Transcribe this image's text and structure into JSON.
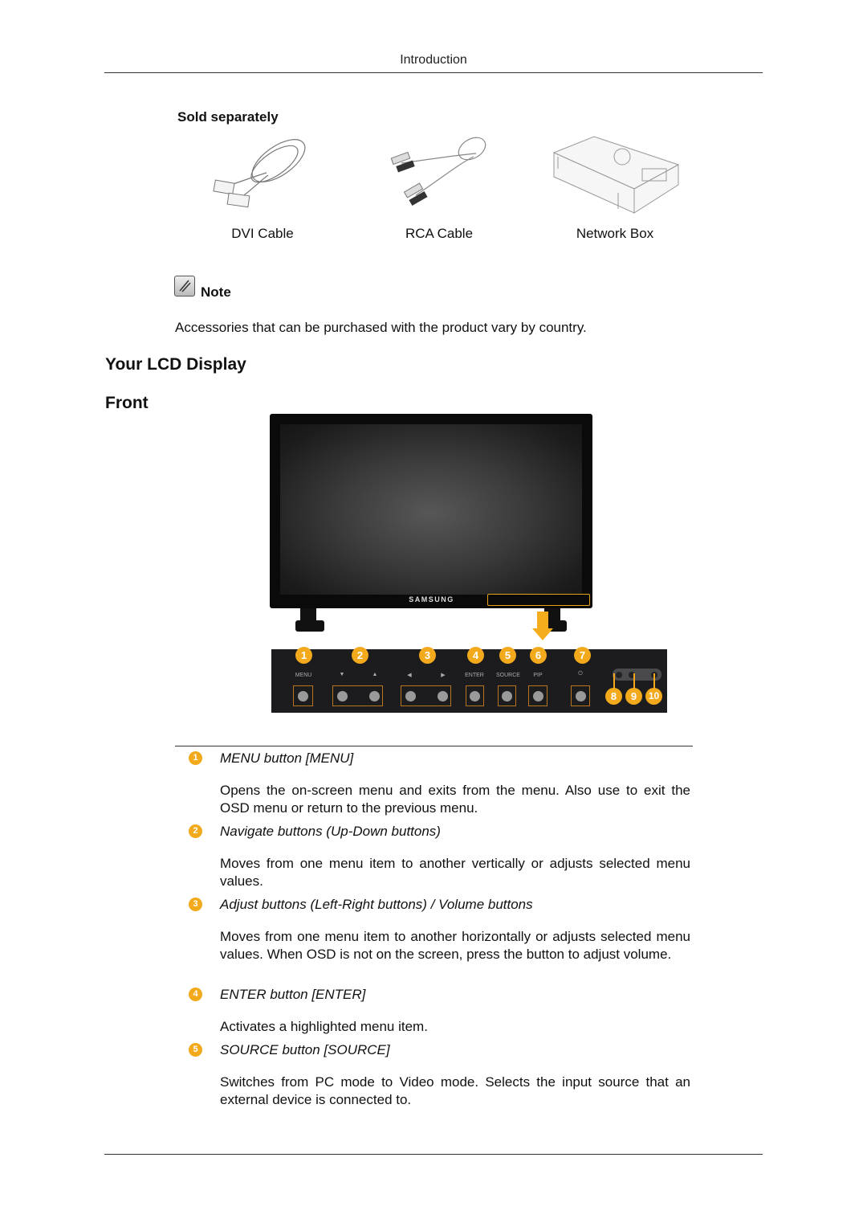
{
  "header": {
    "section_title": "Introduction"
  },
  "sold_separately": {
    "heading": "Sold separately",
    "items": [
      {
        "label": "DVI Cable",
        "icon": "dvi-cable-illustration"
      },
      {
        "label": "RCA Cable",
        "icon": "rca-cable-illustration"
      },
      {
        "label": "Network Box",
        "icon": "network-box-illustration"
      }
    ]
  },
  "note": {
    "label": "Note",
    "text": "Accessories that can be purchased with the product vary by country."
  },
  "section": {
    "title": "Your LCD Display",
    "subtitle": "Front"
  },
  "monitor": {
    "brand": "SAMSUNG",
    "accent_color": "#f2a91c"
  },
  "control_panel": {
    "badges": [
      "1",
      "2",
      "3",
      "4",
      "5",
      "6",
      "7",
      "8",
      "9",
      "10"
    ],
    "labels": [
      "MENU",
      "▼",
      "▲",
      "◀",
      "▶",
      "ENTER",
      "SOURCE",
      "PIP",
      "⏻"
    ]
  },
  "items": [
    {
      "num": "1",
      "title": "MENU button [MENU]",
      "desc": "Opens the on-screen menu and exits from the menu. Also use to exit the OSD menu or return to the previous menu."
    },
    {
      "num": "2",
      "title": "Navigate buttons (Up-Down buttons)",
      "desc": "Moves from one menu item to another vertically or adjusts selected menu values."
    },
    {
      "num": "3",
      "title": "Adjust buttons (Left-Right buttons) / Volume buttons",
      "desc": "Moves from one menu item to another horizontally or adjusts selected menu values. When OSD is not on the screen, press the button to adjust volume."
    },
    {
      "num": "4",
      "title": "ENTER button [ENTER]",
      "desc": "Activates a highlighted menu item."
    },
    {
      "num": "5",
      "title": "SOURCE button [SOURCE]",
      "desc": "Switches from PC mode to Video mode. Selects the input source that an external device is connected to."
    }
  ]
}
